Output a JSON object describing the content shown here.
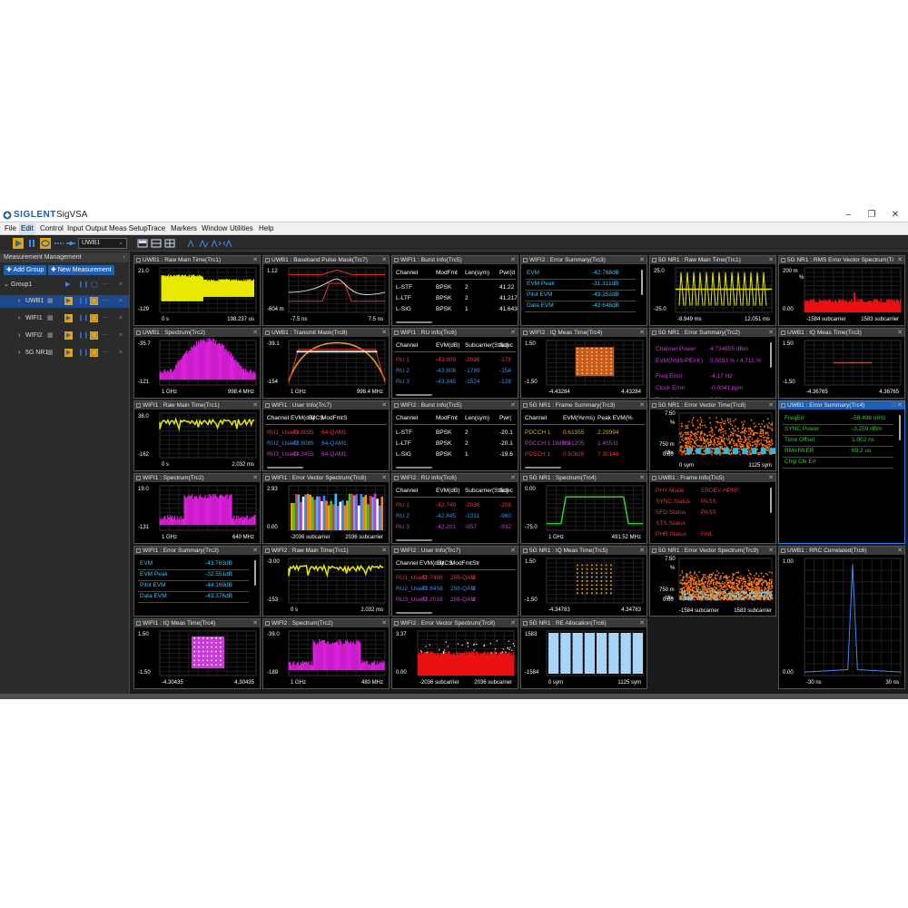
{
  "app": {
    "brand": "SIGLENT",
    "name": "SigVSA"
  },
  "menu": [
    "File",
    "Edit",
    "Control",
    "Input Output",
    "Meas Setup",
    "Trace",
    "Markers",
    "Window",
    "Utilities",
    "Help"
  ],
  "toolbar": {
    "group_select": "UWB1"
  },
  "sidebar": {
    "title": "Measurement Management",
    "add_group": "Add Group",
    "new_measurement": "New Measurement",
    "group": "Group1",
    "measurements": [
      "UWB1",
      "WIFI1",
      "WIFI2",
      "5G NR1"
    ]
  },
  "panels": [
    {
      "title": "UWB1 : Raw Main Time(Trc1)",
      "y": [
        "21.0",
        "-129"
      ],
      "x": [
        "0 s",
        "198.237 us"
      ]
    },
    {
      "title": "UWB1 : Baseband Pulse Mask(Trc7)",
      "y": [
        "1.12",
        "-604 m"
      ],
      "x": [
        "-7.5 ns",
        "7.5 ns"
      ]
    },
    {
      "title": "WIFI1 : Burst Info(Trc5)",
      "cols": [
        "Channel",
        "ModFmt",
        "Len(sym)",
        "Pwr(d"
      ],
      "rows": [
        [
          "L-STF",
          "BPSK",
          "2",
          "41.22"
        ],
        [
          "L-LTF",
          "BPSK",
          "2",
          "41.217"
        ],
        [
          "L-SIG",
          "BPSK",
          "1",
          "41.643"
        ]
      ]
    },
    {
      "title": "WIFI2 : Error Summary(Trc3)",
      "rows": [
        [
          "EVM",
          "-42.768dB"
        ],
        [
          "EVM Peak",
          "-31.311dB"
        ],
        [
          "Pilot EVM",
          "-43.252dB"
        ],
        [
          "Data EVM",
          "-42.648dB"
        ]
      ]
    },
    {
      "title": "5G NR1 : Raw Main Time(Trc1)",
      "y": [
        "25.0",
        "-25.0"
      ],
      "x": [
        "-8.949 ms",
        "12.051 ms"
      ]
    },
    {
      "title": "5G NR1 : RMS Error Vector Spectrum(Tr",
      "unit": "%",
      "y": [
        "200 m",
        "/div",
        "0.00"
      ],
      "x": [
        "-1584 subcarrier",
        "1583 subcarrier"
      ]
    },
    {
      "title": "UWB1 : Spectrum(Trc2)",
      "y": [
        "-35.7",
        "-121"
      ],
      "x": [
        "1 GHz",
        "998.4 MHz"
      ]
    },
    {
      "title": "UWB1 : Transmit Mask(Trc8)",
      "y": [
        "-39.1",
        "-154"
      ],
      "x": [
        "1 GHz",
        "998.4 MHz"
      ]
    },
    {
      "title": "WIFI1 : RU Info(Trc6)",
      "cols": [
        "Channel",
        "EVM(dB)",
        "Subcarrier(Start)",
        "Subc"
      ],
      "rows": [
        [
          "RU 1",
          "-43.809",
          "-2036",
          "-178"
        ],
        [
          "RU 2",
          "-43.808",
          "-1789",
          "-154"
        ],
        [
          "RU 3",
          "-43.345",
          "-1524",
          "-128"
        ]
      ]
    },
    {
      "title": "WIFI2 : IQ Meas Time(Trc4)",
      "y": [
        "1.50",
        "-1.50"
      ],
      "x": [
        "-4.43284",
        "4.43284"
      ]
    },
    {
      "title": "5G NR1 : Error Summary(Trc2)",
      "rows": [
        [
          "Channel Power",
          "4.734655 dBm"
        ],
        [
          "EVM(RMS/PEAK)",
          "0.5093 % / 4.711 %"
        ],
        [
          "Freq Error",
          "-4.17 Hz"
        ],
        [
          "Clock Error",
          "-0.0041 ppm"
        ],
        [
          "Time Offset",
          "0.00 ns"
        ]
      ]
    },
    {
      "title": "UWB1 : IQ Meas Time(Trc3)",
      "y": [
        "1.50",
        "-1.50"
      ],
      "x": [
        "-4.36765",
        "4.36765"
      ]
    },
    {
      "title": "WIFI1 : Raw Main Time(Trc1)",
      "y": [
        "38.0",
        "-162"
      ],
      "x": [
        "0 s",
        "2.032 ms"
      ]
    },
    {
      "title": "WIFI1 : User Info(Trc7)",
      "cols": [
        "Channel",
        "EVM(dB)",
        "MCS",
        "ModFmt",
        "S"
      ],
      "rows": [
        [
          "RU1_User0",
          "-43.809",
          "5",
          "64-QAM",
          "1"
        ],
        [
          "RU2_User0",
          "-43.808",
          "5",
          "64-QAM",
          "1"
        ],
        [
          "RU3_User0",
          "-43.345",
          "5",
          "64-QAM",
          "1"
        ]
      ]
    },
    {
      "title": "WIFI2 : Burst Info(Trc5)",
      "cols": [
        "Channel",
        "ModFmt",
        "Len(sym)",
        "Pwr("
      ],
      "rows": [
        [
          "L-STF",
          "BPSK",
          "2",
          "-20.1"
        ],
        [
          "L-LTF",
          "BPSK",
          "2",
          "-20.1"
        ],
        [
          "L-SIG",
          "BPSK",
          "1",
          "-19.6"
        ]
      ]
    },
    {
      "title": "5G NR1 : Frame Summary(Trc3)",
      "cols": [
        "Channel",
        "EVM(%rms)",
        "Peak EVM(%"
      ],
      "rows": [
        [
          "PDCCH 1",
          "0.61355",
          "2.29994"
        ],
        [
          "PDCCH 1 DMRS",
          "0.41205",
          "1.45531"
        ],
        [
          "PDSCH 1",
          "0.50826",
          "7.30148"
        ]
      ]
    },
    {
      "title": "5G NR1 : Error Vector Time(Trc8)",
      "unit": "%",
      "y": [
        "7.50",
        "750 m",
        "/div",
        "0.00"
      ],
      "x": [
        "0 sym",
        "1125 sym"
      ]
    },
    {
      "title": "UWB1 : Error Summary(Trc4)",
      "rows": [
        [
          "FreqErr",
          "-58.498 mHz"
        ],
        [
          "SYNC Power",
          "-3.259 dBm"
        ],
        [
          "Time Offset",
          "1.002 ns"
        ],
        [
          "RMARKER",
          "69.2 us"
        ],
        [
          "Chip Clk Err",
          ""
        ]
      ]
    },
    {
      "title": "WIFI1 : Spectrum(Trc2)",
      "y": [
        "19.0",
        "-131"
      ],
      "x": [
        "1 GHz",
        "640 MHz"
      ]
    },
    {
      "title": "WIFI1 : Error Vector Spectrum(Trc8)",
      "y": [
        "2.93",
        "0.00"
      ],
      "x": [
        "-2036 subcarrier",
        "2036 subcarrier"
      ]
    },
    {
      "title": "WIFI2 : RU Info(Trc6)",
      "cols": [
        "Channel",
        "EVM(dB)",
        "Subcarrier(Start)",
        "Subc"
      ],
      "rows": [
        [
          "RU 1",
          "-42.749",
          "-2036",
          "-208"
        ],
        [
          "RU 2",
          "-42.845",
          "-1011",
          "-960"
        ],
        [
          "RU 3",
          "-42.201",
          "-957",
          "-932"
        ]
      ]
    },
    {
      "title": "5G NR1 : Spectrum(Trc4)",
      "y": [
        "0.00",
        "-75.0"
      ],
      "x": [
        "1 GHz",
        "491.52 MHz"
      ]
    },
    {
      "title": "UWB1 : Frame Info(Trc5)",
      "rows": [
        [
          "PHY Mode",
          "ERDEV-HPRF"
        ],
        [
          "SYNC Status",
          "PASS"
        ],
        [
          "SFD Status",
          "PASS"
        ],
        [
          "STS Status",
          ""
        ],
        [
          "PHR Status",
          "FAIL"
        ]
      ]
    },
    {
      "title": "WIFI1 : Error Summary(Trc3)",
      "rows": [
        [
          "EVM",
          "-43.763dB"
        ],
        [
          "EVM Peak",
          "-32.551dB"
        ],
        [
          "Pilot EVM",
          "-44.169dB"
        ],
        [
          "Data EVM",
          "-43.376dB"
        ]
      ]
    },
    {
      "title": "WIFI2 : Raw Main Time(Trc1)",
      "y": [
        "-3.00",
        "-153"
      ],
      "x": [
        "0 s",
        "2.032 ms"
      ]
    },
    {
      "title": "WIFI2 : User Info(Trc7)",
      "cols": [
        "Channel",
        "EVM(dB)",
        "MCS",
        "ModFmt",
        "Str"
      ],
      "rows": [
        [
          "RU1_User0",
          "-42.749",
          "8",
          "256-QAM",
          "1"
        ],
        [
          "RU2_User0",
          "-42.845",
          "8",
          "256-QAM",
          "1"
        ],
        [
          "RU3_User0",
          "-42.201",
          "8",
          "256-QAM",
          "1"
        ]
      ]
    },
    {
      "title": "5G NR1 : IQ Meas Time(Trc5)",
      "y": [
        "1.50",
        "-1.50"
      ],
      "x": [
        "-4.34783",
        "4.34783"
      ]
    },
    {
      "title": "5G NR1 : Error Vector Spectrum(Trc9)",
      "unit": "%",
      "y": [
        "7.50",
        "750 m",
        "/div",
        "0.00"
      ],
      "x": [
        "-1584 subcarrier",
        "1583 subcarrier"
      ]
    },
    {
      "title": "UWB1 : RRC Correlated(Trc6)",
      "y": [
        "1.00",
        "0.00"
      ],
      "x": [
        "-30 ns",
        "30 ns"
      ]
    },
    {
      "title": "WIFI1 : IQ Meas Time(Trc4)",
      "y": [
        "1.50",
        "-1.50"
      ],
      "x": [
        "-4.30435",
        "4.30435"
      ]
    },
    {
      "title": "WIFI2 : Spectrum(Trc2)",
      "y": [
        "-39.0",
        "-189"
      ],
      "x": [
        "1 GHz",
        "480 MHz"
      ]
    },
    {
      "title": "WIFI2 : Error Vector Spectrum(Trc8)",
      "y": [
        "3.37",
        "0.00"
      ],
      "x": [
        "-2036 subcarrier",
        "2036 subcarrier"
      ]
    },
    {
      "title": "5G NR1 : RE Allocation(Trc6)",
      "y": [
        "1583",
        "-1584"
      ],
      "x": [
        "0 sym",
        "1125 sym"
      ]
    }
  ]
}
